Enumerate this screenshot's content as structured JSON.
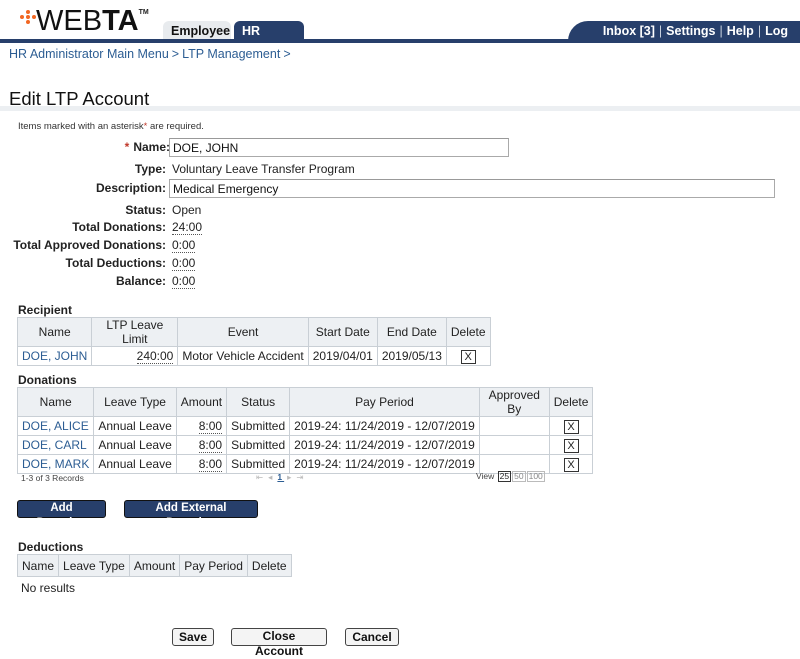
{
  "header": {
    "logo_text_light": "WEB",
    "logo_text_bold": "TA",
    "logo_tm": "TM",
    "brand_color": "#273f6b",
    "logo_accent": "#f26722",
    "tabs": [
      {
        "label": "Employee",
        "active": false
      },
      {
        "label": "HR Admin",
        "active": true
      }
    ],
    "links": [
      {
        "label": "Inbox [3]"
      },
      {
        "label": "Settings"
      },
      {
        "label": "Help"
      },
      {
        "label": "Log Out"
      }
    ],
    "separator": "|"
  },
  "breadcrumb": {
    "items": [
      {
        "label": "HR Administrator Main Menu"
      },
      {
        "label": "LTP Management"
      }
    ],
    "separator": ">"
  },
  "page": {
    "title": "Edit LTP Account",
    "required_note_prefix": "Items marked with an asterisk",
    "required_note_mark": "*",
    "required_note_suffix": " are required."
  },
  "form": {
    "name": {
      "label": "Name:",
      "required_mark": "*",
      "value": "DOE, JOHN"
    },
    "type": {
      "label": "Type:",
      "value": "Voluntary Leave Transfer Program"
    },
    "description": {
      "label": "Description:",
      "value": "Medical Emergency"
    },
    "status": {
      "label": "Status:",
      "value": "Open"
    },
    "total_donations": {
      "label": "Total Donations:",
      "value": "24:00"
    },
    "total_approved_donations": {
      "label": "Total Approved Donations:",
      "value": "0:00"
    },
    "total_deductions": {
      "label": "Total Deductions:",
      "value": "0:00"
    },
    "balance": {
      "label": "Balance:",
      "value": "0:00"
    }
  },
  "recipient": {
    "title": "Recipient",
    "columns": [
      "Name",
      "LTP Leave Limit",
      "Event",
      "Start Date",
      "End Date",
      "Delete"
    ],
    "rows": [
      {
        "name": "DOE, JOHN",
        "limit": "240:00",
        "event": "Motor Vehicle Accident",
        "start": "2019/04/01",
        "end": "2019/05/13",
        "delete": "X"
      }
    ]
  },
  "donations": {
    "title": "Donations",
    "columns": [
      "Name",
      "Leave Type",
      "Amount",
      "Status",
      "Pay Period",
      "Approved By",
      "Delete"
    ],
    "rows": [
      {
        "name": "DOE, ALICE",
        "leave_type": "Annual Leave",
        "amount": "8:00",
        "status": "Submitted",
        "pay_period": "2019-24: 11/24/2019 - 12/07/2019",
        "approved_by": "",
        "delete": "X"
      },
      {
        "name": "DOE, CARL",
        "leave_type": "Annual Leave",
        "amount": "8:00",
        "status": "Submitted",
        "pay_period": "2019-24: 11/24/2019 - 12/07/2019",
        "approved_by": "",
        "delete": "X"
      },
      {
        "name": "DOE, MARK",
        "leave_type": "Annual Leave",
        "amount": "8:00",
        "status": "Submitted",
        "pay_period": "2019-24: 11/24/2019 - 12/07/2019",
        "approved_by": "",
        "delete": "X"
      }
    ],
    "records_text": "1-3 of 3 Records",
    "pager": {
      "first": "⇤",
      "prev": "◂",
      "current": "1",
      "next": "▸",
      "last": "⇥"
    },
    "view_label": "View",
    "view_options": [
      "25",
      "50",
      "100"
    ],
    "view_selected": "25",
    "add_donation_label": "Add Donation",
    "add_external_label": "Add External Donation"
  },
  "deductions": {
    "title": "Deductions",
    "columns": [
      "Name",
      "Leave Type",
      "Amount",
      "Pay Period",
      "Delete"
    ],
    "empty_text": "No results"
  },
  "actions": {
    "save": "Save",
    "close_account": "Close Account",
    "cancel": "Cancel"
  }
}
